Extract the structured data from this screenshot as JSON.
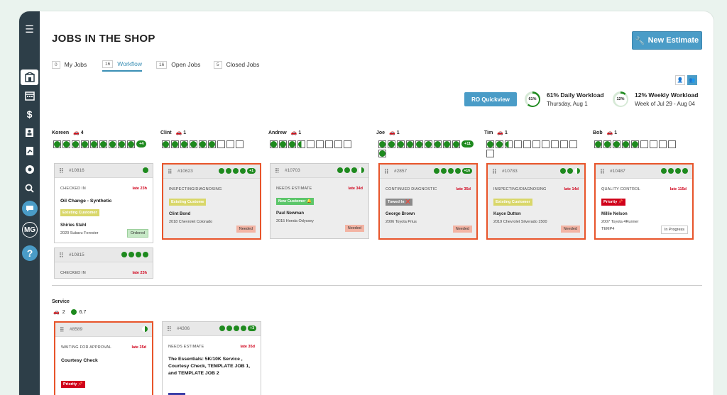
{
  "page": {
    "title": "JOBS IN THE SHOP",
    "new_estimate_label": "New Estimate"
  },
  "sidebar": {
    "avatar_initials": "MG"
  },
  "tabs": [
    {
      "count": "0",
      "label": "My Jobs"
    },
    {
      "count": "16",
      "label": "Workflow"
    },
    {
      "count": "16",
      "label": "Open Jobs"
    },
    {
      "count": "5",
      "label": "Closed Jobs"
    }
  ],
  "ro_quickview_label": "RO Quickview",
  "workload": {
    "daily": {
      "percent_label": "61%",
      "value": 61,
      "title": "61% Daily Workload",
      "date": "Thursday, Aug 1"
    },
    "weekly": {
      "percent_label": "12%",
      "value": 12,
      "title": "12% Weekly Workload",
      "date": "Week of Jul 29 - Aug 04"
    }
  },
  "columns": [
    {
      "tech": "Koreen",
      "cars": "4"
    },
    {
      "tech": "Clint",
      "cars": "1"
    },
    {
      "tech": "Andrew",
      "cars": "1"
    },
    {
      "tech": "Joe",
      "cars": "1"
    },
    {
      "tech": "Tim",
      "cars": "1"
    },
    {
      "tech": "Bob",
      "cars": "1"
    }
  ],
  "slot_plus": {
    "koreen": "+4",
    "joe": "+11"
  },
  "cards": {
    "c10816": {
      "num": "#10816",
      "status": "CHECKED IN",
      "late": "late 23h",
      "service": "Oil Change - Synthetic",
      "badge": "Existing Customer",
      "customer": "Shiries Stahl",
      "vehicle": "2020 Subaru Forester",
      "pill": "Ordered"
    },
    "c10815": {
      "num": "#10815",
      "status": "CHECKED IN",
      "late": "late 23h"
    },
    "c10623": {
      "num": "#10623",
      "plus": "+1",
      "status": "INSPECTING/DIAGNOSING",
      "badge": "Existing Custome",
      "customer": "Clint Bond",
      "vehicle": "2018 Chevrolet Colorado",
      "pill": "Needed"
    },
    "c10703": {
      "num": "#10703",
      "status": "NEEDS ESTIMATE",
      "late": "late 34d",
      "badge": "New Customer 🔔",
      "customer": "Paul Newman",
      "vehicle": "2015 Honda Odyssey",
      "pill": "Needed"
    },
    "c2857": {
      "num": "#2857",
      "plus": "+16",
      "status": "CONTINUED DIAGNOSTIC",
      "late": "late 35d",
      "badge": "Towed In ❌",
      "customer": "George Brown",
      "vehicle": "2006 Toyota Prius",
      "pill": "Needed"
    },
    "c10783": {
      "num": "#10783",
      "status": "INSPECTING/DIAGNOSING",
      "late": "late 14d",
      "badge": "Existing Customer",
      "customer": "Kayce Dutton",
      "vehicle": "2019 Chevrolet Silverado 1500",
      "pill": "Needed"
    },
    "c10487": {
      "num": "#10487",
      "status": "QUALITY CONTROL",
      "late": "late 115d",
      "badge": "Priority 📌",
      "customer": "Millie Nelson",
      "vehicle": "2007 Toyota 4Runner",
      "vehicle2": "TEMP4",
      "pill": "In Progress"
    },
    "c8589": {
      "num": "#8589",
      "status": "WAITING FOR APPROVAL",
      "late": "late 35d",
      "service": "Courtesy Check",
      "badge": "Priority 📌"
    },
    "c4306": {
      "num": "#4306",
      "plus": "+3",
      "status": "NEEDS ESTIMATE",
      "late": "late 35d",
      "service": "The Essentials: 5K/10K Service , Courtesy Check, TEMPLATE JOB 1, and TEMPLATE JOB 2"
    }
  },
  "service_section": {
    "title": "Service",
    "cars": "2",
    "hours": "6.7"
  },
  "colors": {
    "accent": "#4a9cc7",
    "late": "#d0021b",
    "green": "#1e8a1e",
    "alert_border": "#e8542a",
    "sidebar": "#2d3e48"
  }
}
